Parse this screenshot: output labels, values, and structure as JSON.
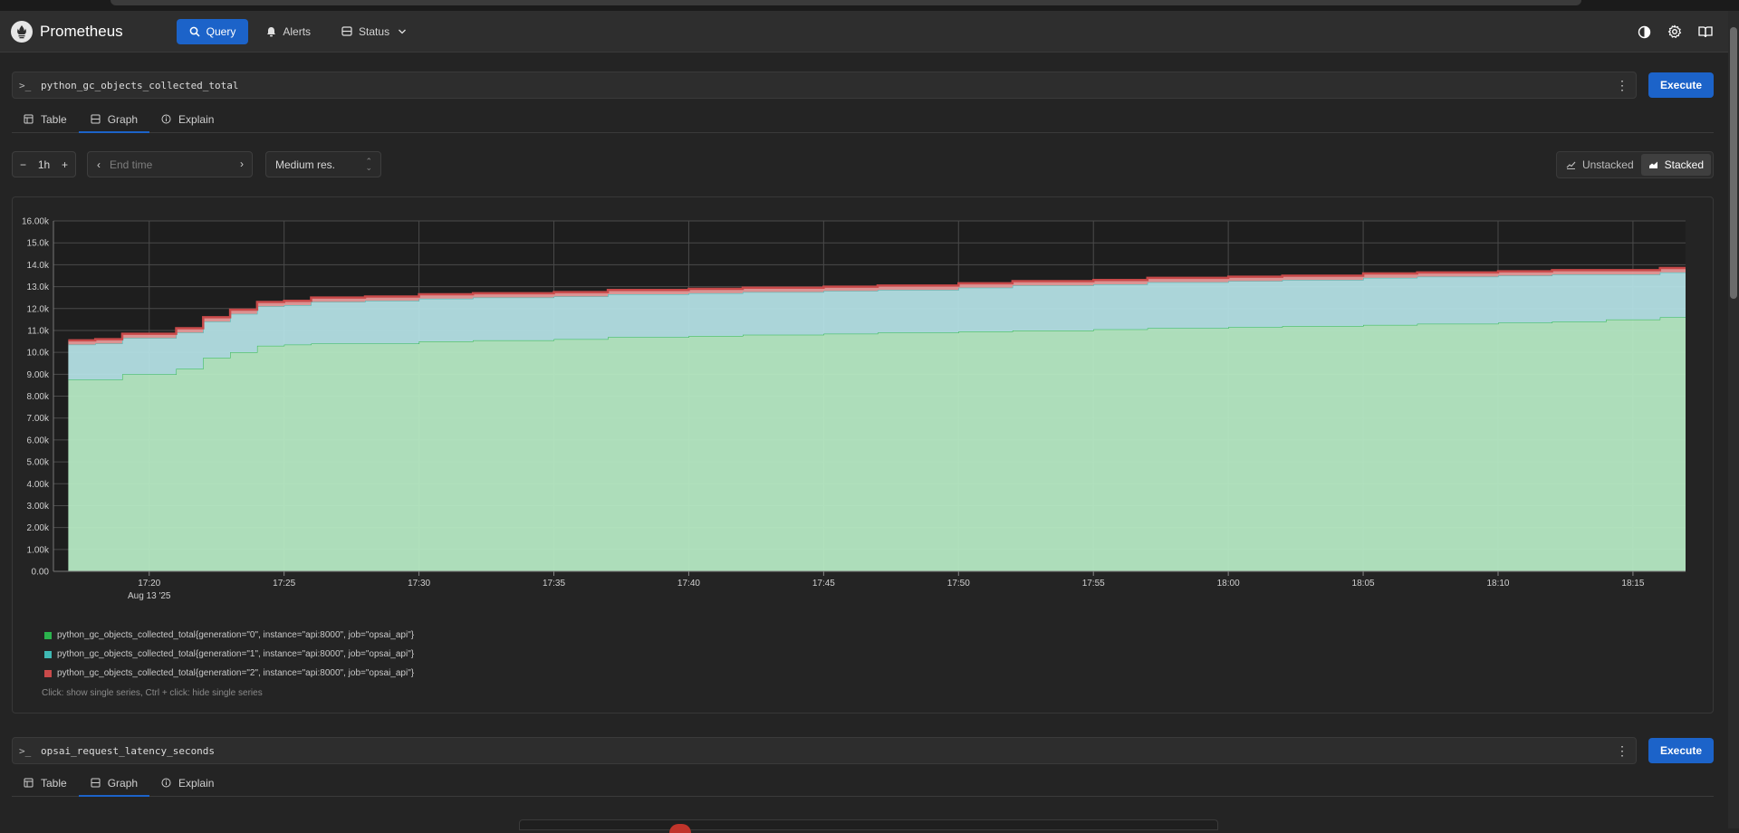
{
  "app": {
    "name": "Prometheus",
    "nav": [
      {
        "label": "Query",
        "icon": "search-icon",
        "active": true
      },
      {
        "label": "Alerts",
        "icon": "bell-icon",
        "active": false
      },
      {
        "label": "Status",
        "icon": "server-icon",
        "active": false
      }
    ],
    "right_icons": [
      "theme-toggle-icon",
      "settings-icon",
      "docs-book-icon"
    ]
  },
  "panel1": {
    "prompt": ">_",
    "expression": "python_gc_objects_collected_total",
    "execute_label": "Execute",
    "tabs": [
      {
        "label": "Table",
        "icon": "table-icon"
      },
      {
        "label": "Graph",
        "icon": "graph-icon",
        "active": true
      },
      {
        "label": "Explain",
        "icon": "info-icon"
      }
    ],
    "range": {
      "minus": "−",
      "value": "1h",
      "plus": "+"
    },
    "end_time_placeholder": "End time",
    "resolution": "Medium res.",
    "stack_toggle": {
      "unstacked": "Unstacked",
      "stacked": "Stacked",
      "active": "stacked"
    },
    "legend_hint": "Click: show single series, Ctrl + click: hide single series"
  },
  "panel2": {
    "prompt": ">_",
    "expression": "opsai_request_latency_seconds",
    "execute_label": "Execute",
    "tabs": [
      {
        "label": "Table",
        "icon": "table-icon"
      },
      {
        "label": "Graph",
        "icon": "graph-icon",
        "active": true
      },
      {
        "label": "Explain",
        "icon": "info-icon"
      }
    ]
  },
  "chart_data": {
    "type": "area",
    "stacked": true,
    "y_ticks": [
      "0.00",
      "1.00k",
      "2.00k",
      "3.00k",
      "4.00k",
      "5.00k",
      "6.00k",
      "7.00k",
      "8.00k",
      "9.00k",
      "10.0k",
      "11.0k",
      "12.0k",
      "13.0k",
      "14.0k",
      "15.0k",
      "16.00k"
    ],
    "ylim": [
      0,
      16000
    ],
    "x_ticks": [
      "17:20",
      "17:25",
      "17:30",
      "17:35",
      "17:40",
      "17:45",
      "17:50",
      "17:55",
      "18:00",
      "18:05",
      "18:10",
      "18:15"
    ],
    "x_date_label": "Aug 13 '25",
    "x": [
      "17:17",
      "17:18",
      "17:19",
      "17:20",
      "17:21",
      "17:22",
      "17:23",
      "17:24",
      "17:25",
      "17:26",
      "17:28",
      "17:30",
      "17:32",
      "17:35",
      "17:37",
      "17:40",
      "17:42",
      "17:45",
      "17:47",
      "17:50",
      "17:52",
      "17:55",
      "17:57",
      "18:00",
      "18:02",
      "18:05",
      "18:07",
      "18:10",
      "18:12",
      "18:14",
      "18:16"
    ],
    "grid": true,
    "legend_position": "bottom",
    "series": [
      {
        "name": "python_gc_objects_collected_total{generation=\"0\", instance=\"api:8000\", job=\"opsai_api\"}",
        "color": "#2bb34d",
        "fill": "#b5e8c3",
        "values": [
          8750,
          8750,
          9000,
          9000,
          9250,
          9750,
          10000,
          10300,
          10350,
          10400,
          10400,
          10500,
          10550,
          10600,
          10700,
          10750,
          10800,
          10850,
          10900,
          10950,
          11000,
          11050,
          11100,
          11150,
          11200,
          11250,
          11300,
          11350,
          11400,
          11500,
          11600
        ]
      },
      {
        "name": "python_gc_objects_collected_total{generation=\"1\", instance=\"api:8000\", job=\"opsai_api\"}",
        "color": "#3fb8b3",
        "fill": "#b3dfe4",
        "values": [
          1600,
          1650,
          1650,
          1650,
          1650,
          1650,
          1750,
          1800,
          1800,
          1900,
          1950,
          1950,
          1950,
          1950,
          1950,
          1950,
          1950,
          1950,
          1950,
          2000,
          2050,
          2050,
          2100,
          2100,
          2100,
          2150,
          2150,
          2150,
          2150,
          2050,
          2050
        ]
      },
      {
        "name": "python_gc_objects_collected_total{generation=\"2\", instance=\"api:8000\", job=\"opsai_api\"}",
        "color": "#c94a4a",
        "fill": "#e69a9a",
        "values": [
          200,
          200,
          200,
          200,
          200,
          200,
          200,
          200,
          200,
          200,
          200,
          200,
          200,
          200,
          200,
          200,
          200,
          200,
          200,
          200,
          200,
          200,
          200,
          200,
          200,
          200,
          200,
          200,
          200,
          200,
          200
        ]
      }
    ]
  }
}
